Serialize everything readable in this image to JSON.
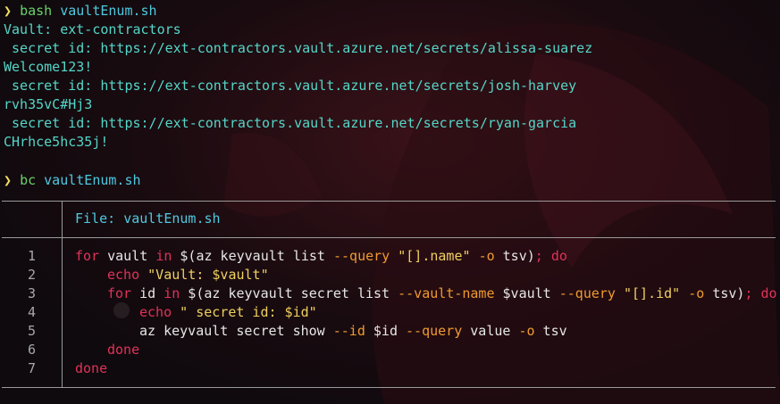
{
  "colors": {
    "background": "#160a0e",
    "prompt": "#f0e060",
    "command": "#69d26b",
    "argument": "#4fc9e0",
    "output": "#55d6c8",
    "keyword": "#e0325a",
    "string": "#f0d060",
    "flag": "#f09a30",
    "line_number": "#a8a8a8",
    "rule": "#9a9a9a"
  },
  "terminal": {
    "prompt_symbol": "❯",
    "commands": [
      {
        "cmd": "bash",
        "arg": "vaultEnum.sh"
      },
      {
        "cmd": "bc",
        "arg": "vaultEnum.sh"
      }
    ],
    "output": [
      "Vault: ext-contractors",
      " secret id: https://ext-contractors.vault.azure.net/secrets/alissa-suarez",
      "Welcome123!",
      " secret id: https://ext-contractors.vault.azure.net/secrets/josh-harvey",
      "rvh35vC#Hj3",
      " secret id: https://ext-contractors.vault.azure.net/secrets/ryan-garcia",
      "CHrhce5hc35j!"
    ]
  },
  "viewer": {
    "file_label": "File: ",
    "file_name": "vaultEnum.sh",
    "line_numbers": [
      "1",
      "2",
      "3",
      "4",
      "5",
      "6",
      "7"
    ],
    "code": {
      "l1": {
        "kw1": "for",
        "t1": " vault ",
        "kw2": "in",
        "t2": " $(az keyvault list ",
        "f1": "--query",
        "t3": " ",
        "s1": "\"[].name\"",
        "t4": " ",
        "f2": "-o",
        "t5": " tsv)",
        "kw3": ";",
        "t6": " ",
        "kw4": "do"
      },
      "l2": {
        "kw1": "echo",
        "t1": " ",
        "s1": "\"Vault: $vault\""
      },
      "l3": {
        "kw1": "for",
        "t1": " id ",
        "kw2": "in",
        "t2": " $(az keyvault secret list ",
        "f1": "--vault-name",
        "t3": " $vault ",
        "f2": "--query",
        "t4": " ",
        "s1": "\"[].id\"",
        "t5": " ",
        "f3": "-o",
        "t6": " tsv)",
        "kw3": ";",
        "t7": " ",
        "kw4": "do"
      },
      "l4": {
        "kw1": "echo",
        "t1": " ",
        "s1": "\" secret id: $id\""
      },
      "l5": {
        "t1": "az keyvault secret show ",
        "f1": "--id",
        "t2": " $id ",
        "f2": "--query",
        "t3": " value ",
        "f3": "-o",
        "t4": " tsv"
      },
      "l6": {
        "kw1": "done"
      },
      "l7": {
        "kw1": "done"
      }
    }
  }
}
